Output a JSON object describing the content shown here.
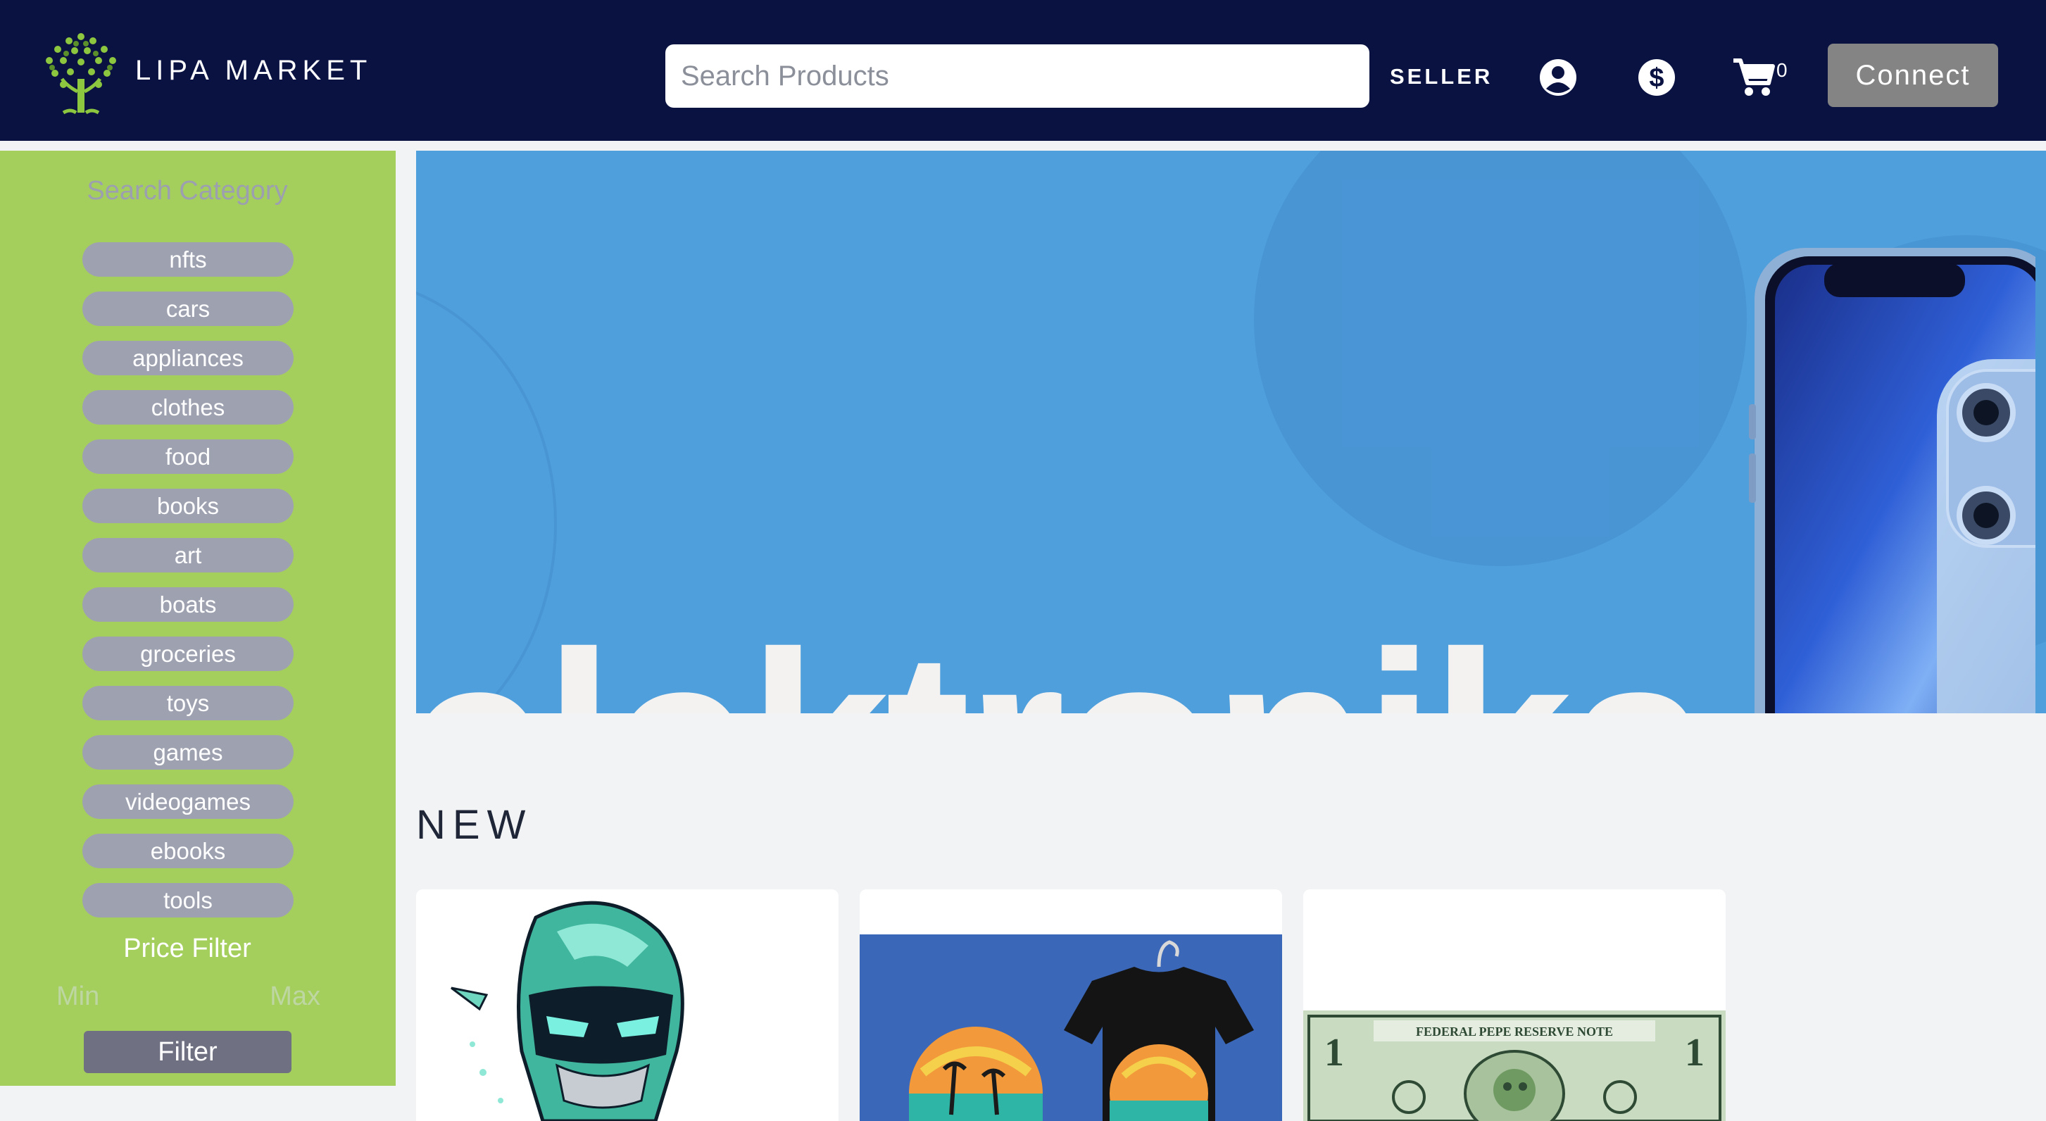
{
  "header": {
    "brand": "LIPA MARKET",
    "search_placeholder": "Search Products",
    "seller_label": "SELLER",
    "cart_count": "0",
    "connect_label": "Connect",
    "icons": [
      "tree-logo-icon",
      "user-circle-icon",
      "dollar-circle-icon",
      "cart-icon"
    ]
  },
  "sidebar": {
    "category_title": "Search Category",
    "categories": [
      "nfts",
      "cars",
      "appliances",
      "clothes",
      "food",
      "books",
      "art",
      "boats",
      "groceries",
      "toys",
      "games",
      "videogames",
      "ebooks",
      "tools"
    ],
    "price_title": "Price Filter",
    "min_placeholder": "Min",
    "max_placeholder": "Max",
    "filter_label": "Filter"
  },
  "banner": {
    "text": "elektronika"
  },
  "section": {
    "title": "NEW"
  },
  "products": [
    {
      "image": "robot-character-image"
    },
    {
      "image": "summer-tshirt-image"
    },
    {
      "image": "pepe-dollar-bill-image"
    }
  ],
  "colors": {
    "header_bg": "#0a1242",
    "sidebar_bg": "#a5cf5d",
    "category_pill": "#9ea1b0",
    "banner_bg": "#4f9fdc",
    "connect_button": "#848484",
    "filter_button": "#6f7183",
    "page_bg": "#f2f3f5"
  }
}
